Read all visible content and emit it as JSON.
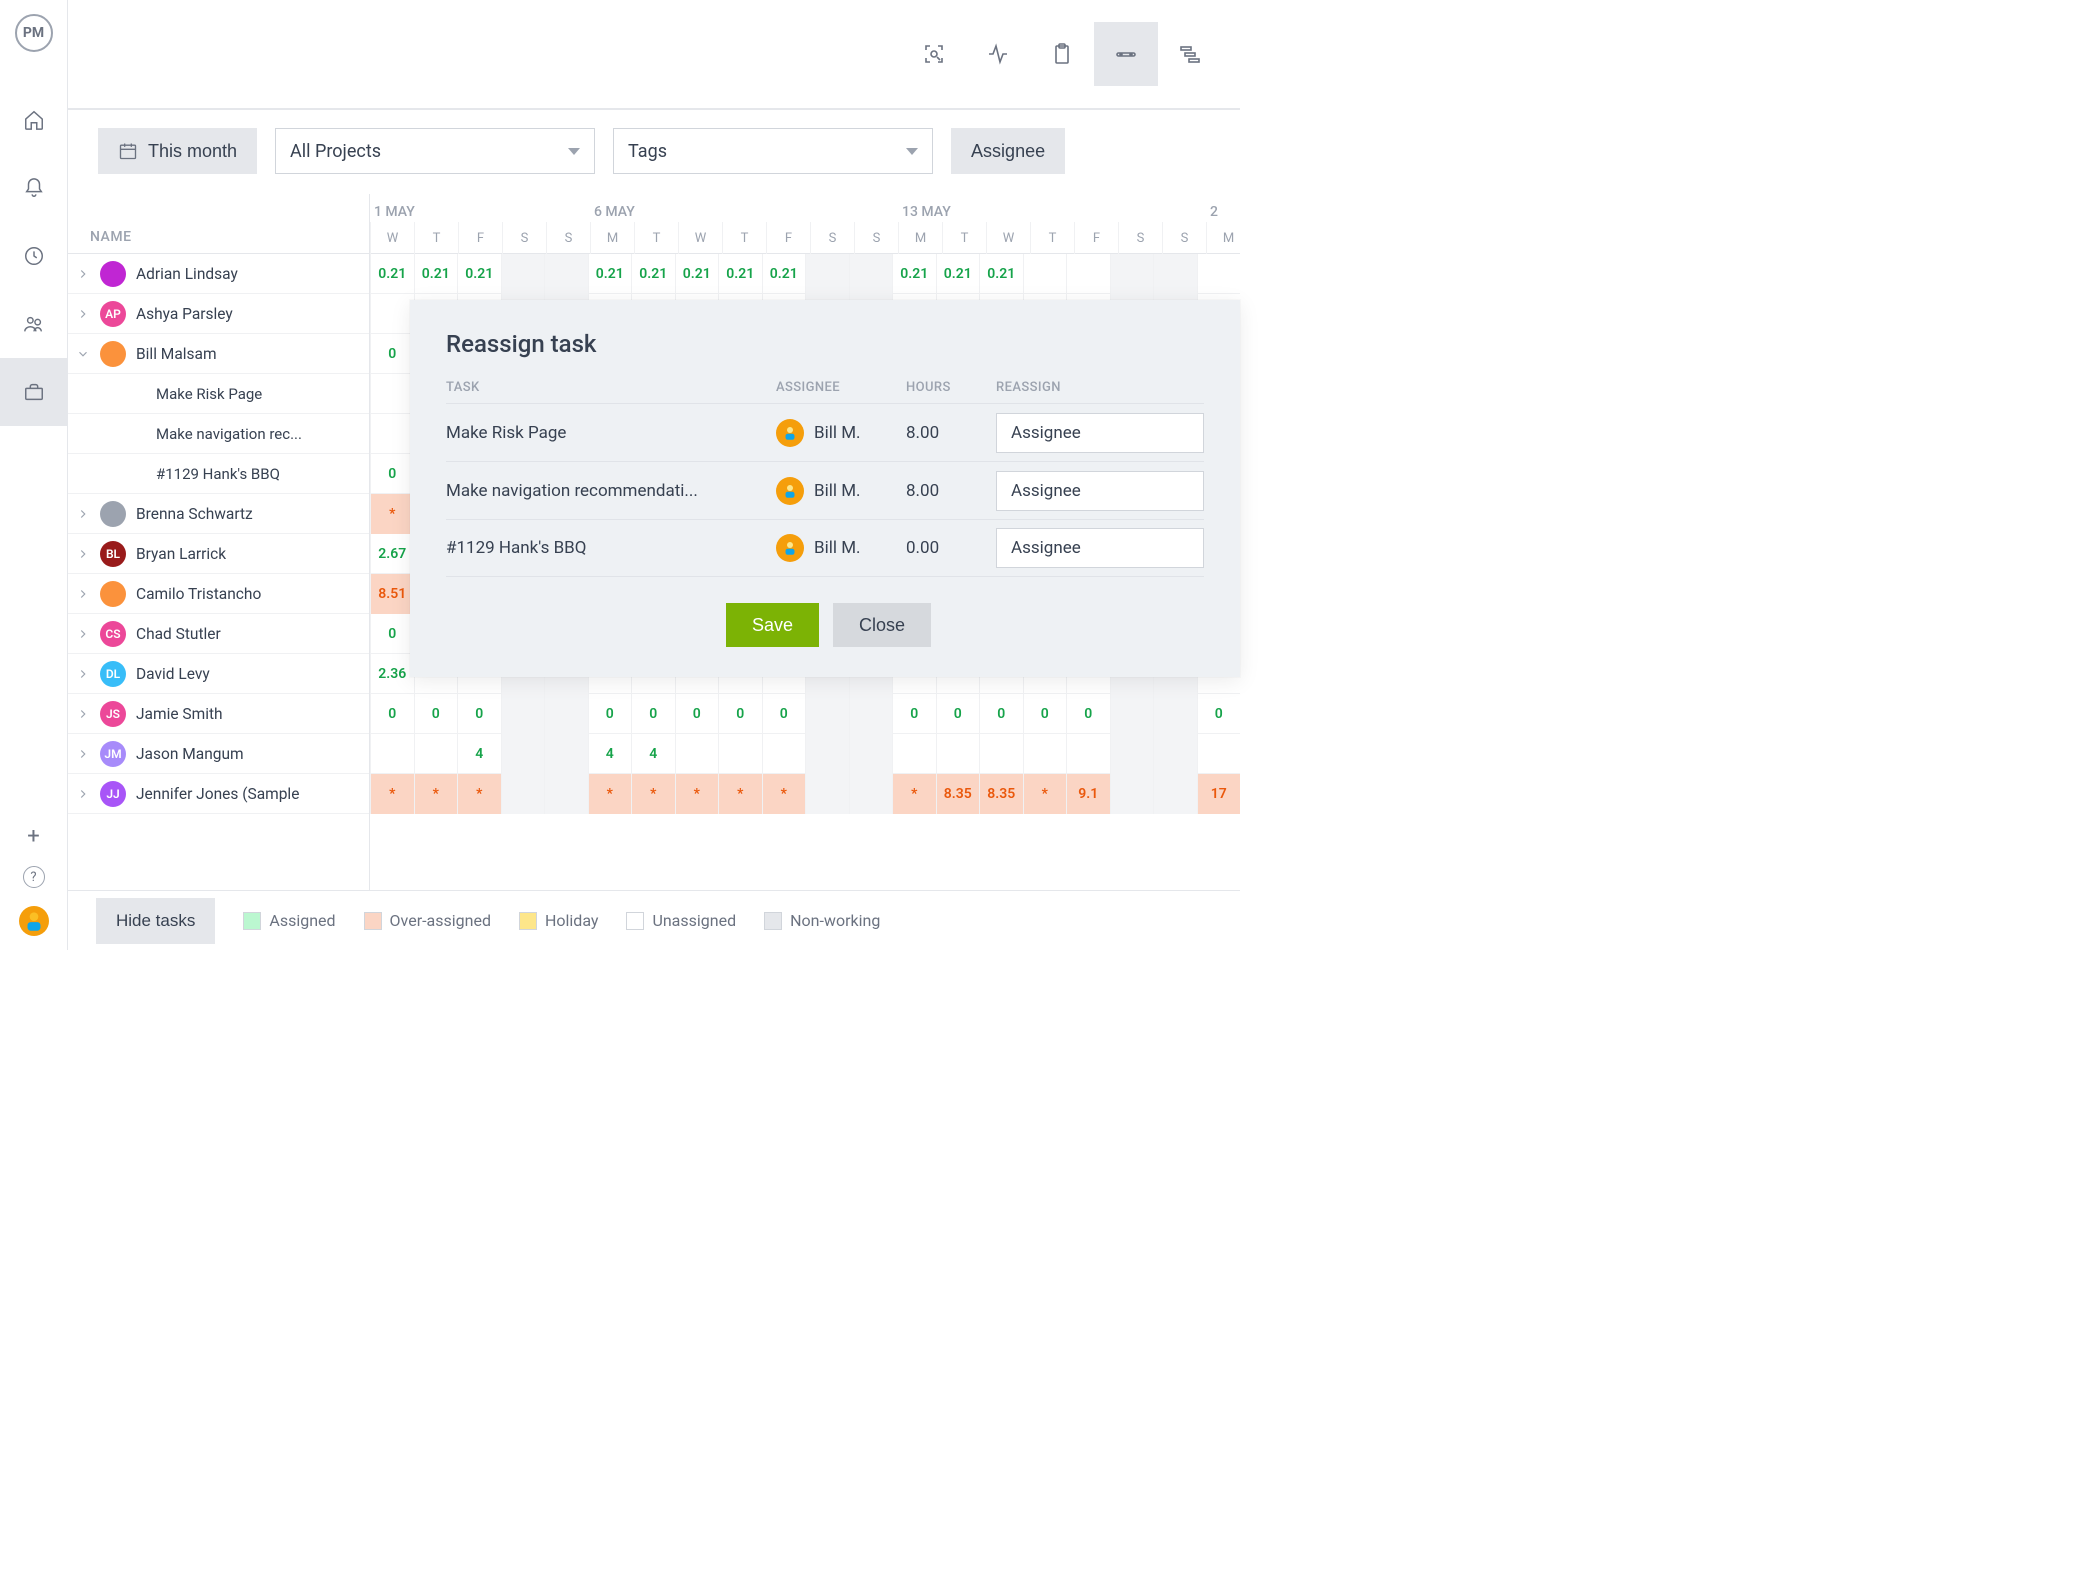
{
  "app": {
    "logo_text": "PM"
  },
  "topbar_views": [
    "scan",
    "pulse",
    "clipboard",
    "timeline",
    "gantt"
  ],
  "active_view_index": 3,
  "filters": {
    "period_label": "This month",
    "projects_label": "All Projects",
    "tags_label": "Tags",
    "assignee_btn": "Assignee"
  },
  "name_header": "NAME",
  "days_header_weeks": [
    {
      "label": "1 MAY",
      "days": [
        "W",
        "T",
        "F",
        "S",
        "S"
      ]
    },
    {
      "label": "6 MAY",
      "days": [
        "M",
        "T",
        "W",
        "T",
        "F",
        "S",
        "S"
      ]
    },
    {
      "label": "13 MAY",
      "days": [
        "M",
        "T",
        "W",
        "T",
        "F",
        "S",
        "S"
      ]
    },
    {
      "label": "2",
      "days": [
        "M"
      ]
    }
  ],
  "people": [
    {
      "name": "Adrian Lindsay",
      "expanded": false,
      "avatar": {
        "bg": "#c026d3",
        "text": ""
      },
      "cells": [
        "0.21",
        "0.21",
        "0.21",
        "",
        "",
        "0.21",
        "0.21",
        "0.21",
        "0.21",
        "0.21",
        "",
        "",
        "0.21",
        "0.21",
        "0.21",
        "",
        "",
        "",
        "",
        ""
      ],
      "style": "green"
    },
    {
      "name": "Ashya Parsley",
      "expanded": false,
      "avatar": {
        "bg": "#ec4899",
        "text": "AP"
      },
      "cells": [
        "",
        "",
        "",
        "",
        "",
        "",
        "",
        "",
        "",
        "",
        "",
        "",
        "",
        "",
        "",
        "",
        "",
        "",
        "",
        ""
      ]
    },
    {
      "name": "Bill Malsam",
      "expanded": true,
      "avatar": {
        "bg": "#fb923c",
        "text": ""
      },
      "children": [
        {
          "label": "Make Risk Page"
        },
        {
          "label": "Make navigation rec..."
        },
        {
          "label": "#1129 Hank's BBQ"
        }
      ],
      "parent_cells": [
        "0",
        "",
        "",
        "",
        "",
        "",
        "",
        "",
        "",
        "",
        "",
        "",
        "",
        "",
        "",
        "",
        "",
        "",
        "",
        ""
      ],
      "style": "green",
      "child_cells": [
        [],
        [],
        [
          "0",
          "",
          "",
          "",
          "",
          "",
          "",
          "",
          "",
          "",
          "",
          "",
          "",
          "",
          "",
          "",
          "",
          "",
          "",
          ""
        ]
      ]
    },
    {
      "name": "Brenna Schwartz",
      "expanded": false,
      "avatar": {
        "bg": "#9ca3af",
        "text": ""
      },
      "cells": [
        "*",
        "",
        "",
        "",
        "",
        "",
        "",
        "",
        "",
        "",
        "",
        "",
        "",
        "",
        "",
        "",
        "",
        "",
        "",
        ""
      ],
      "style": "over-star"
    },
    {
      "name": "Bryan Larrick",
      "expanded": false,
      "avatar": {
        "bg": "#991b1b",
        "text": "BL"
      },
      "cells": [
        "2.67",
        "",
        "",
        "",
        "",
        "",
        "",
        "",
        "",
        "",
        "",
        "",
        "",
        "",
        "",
        "",
        "",
        "",
        "",
        ""
      ],
      "style": "green"
    },
    {
      "name": "Camilo Tristancho",
      "expanded": false,
      "avatar": {
        "bg": "#fb923c",
        "text": ""
      },
      "cells": [
        "8.51",
        "",
        "",
        "",
        "",
        "",
        "",
        "",
        "",
        "",
        "",
        "",
        "",
        "",
        "",
        "",
        "",
        "",
        "",
        ""
      ],
      "style": "over"
    },
    {
      "name": "Chad Stutler",
      "expanded": false,
      "avatar": {
        "bg": "#ec4899",
        "text": "CS"
      },
      "cells": [
        "0",
        "",
        "",
        "",
        "",
        "",
        "",
        "",
        "",
        "",
        "",
        "",
        "",
        "",
        "",
        "",
        "",
        "",
        "",
        ""
      ],
      "style": "green"
    },
    {
      "name": "David Levy",
      "expanded": false,
      "avatar": {
        "bg": "#38bdf8",
        "text": "DL"
      },
      "cells": [
        "2.36",
        "",
        "",
        "",
        "",
        "",
        "",
        "",
        "",
        "",
        "",
        "",
        "",
        "",
        "",
        "",
        "",
        "",
        "",
        ""
      ],
      "style": "green"
    },
    {
      "name": "Jamie Smith",
      "expanded": false,
      "avatar": {
        "bg": "#ec4899",
        "text": "JS"
      },
      "cells": [
        "0",
        "0",
        "0",
        "",
        "",
        "0",
        "0",
        "0",
        "0",
        "0",
        "",
        "",
        "0",
        "0",
        "0",
        "0",
        "0",
        "",
        "",
        "0"
      ],
      "style": "green"
    },
    {
      "name": "Jason Mangum",
      "expanded": false,
      "avatar": {
        "bg": "#a78bfa",
        "text": "JM"
      },
      "cells": [
        "",
        "",
        "4",
        "",
        "",
        "4",
        "4",
        "",
        "",
        "",
        "",
        "",
        "",
        "",
        "",
        "",
        "",
        "",
        "",
        ""
      ],
      "style": "green"
    },
    {
      "name": "Jennifer Jones (Sample",
      "expanded": false,
      "avatar": {
        "bg": "#a855f7",
        "text": "JJ"
      },
      "cells": [
        "*",
        "*",
        "*",
        "",
        "",
        "*",
        "*",
        "*",
        "*",
        "*",
        "",
        "",
        "*",
        "8.35",
        "8.35",
        "*",
        "9.1",
        "",
        "",
        "17"
      ],
      "style": "over-star"
    }
  ],
  "footer": {
    "hide_btn": "Hide tasks",
    "legend": {
      "assigned": "Assigned",
      "over": "Over-assigned",
      "holiday": "Holiday",
      "unassigned": "Unassigned",
      "nonworking": "Non-working"
    }
  },
  "modal": {
    "title": "Reassign task",
    "columns": {
      "task": "TASK",
      "assignee": "ASSIGNEE",
      "hours": "HOURS",
      "reassign": "REASSIGN"
    },
    "rows": [
      {
        "task": "Make Risk Page",
        "assignee": "Bill M.",
        "hours": "8.00",
        "reassign_placeholder": "Assignee"
      },
      {
        "task": "Make navigation recommendati...",
        "assignee": "Bill M.",
        "hours": "8.00",
        "reassign_placeholder": "Assignee"
      },
      {
        "task": "#1129 Hank's BBQ",
        "assignee": "Bill M.",
        "hours": "0.00",
        "reassign_placeholder": "Assignee"
      }
    ],
    "save": "Save",
    "close": "Close"
  },
  "colors": {
    "assigned": "#bbf7d0",
    "over": "#fbd5c4",
    "holiday": "#fde68a",
    "unassigned": "#ffffff",
    "nonworking": "#e5e7eb"
  }
}
